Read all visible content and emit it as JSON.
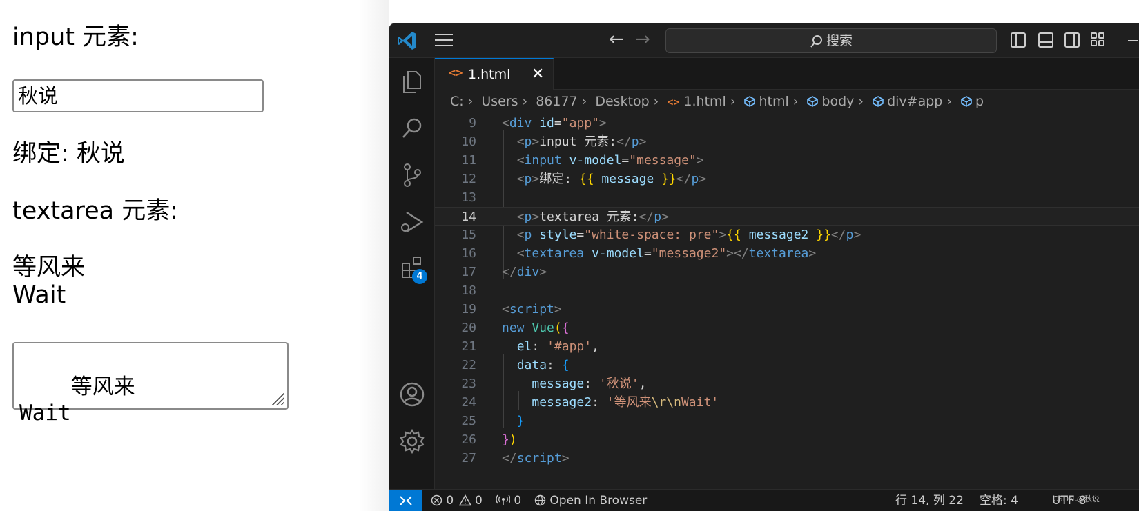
{
  "preview": {
    "p_input_label": "input 元素:",
    "input_value": "秋说",
    "p_bound": "绑定: 秋说",
    "p_textarea_label": "textarea 元素:",
    "pre_text": "等风来\nWait",
    "textarea_value": "等风来\nWait"
  },
  "titlebar": {
    "search_label": "搜索"
  },
  "activity": {
    "extensions_badge": "4"
  },
  "tab": {
    "label": "1.html",
    "close": "✕"
  },
  "breadcrumb": {
    "drive": "C:",
    "users": "Users",
    "user": "86177",
    "desktop": "Desktop",
    "file": "1.html",
    "html": "html",
    "body": "body",
    "app": "div#app",
    "p": "p"
  },
  "code_lines": [
    {
      "n": "9"
    },
    {
      "n": "10"
    },
    {
      "n": "11"
    },
    {
      "n": "12"
    },
    {
      "n": "13"
    },
    {
      "n": "14"
    },
    {
      "n": "15"
    },
    {
      "n": "16"
    },
    {
      "n": "17"
    },
    {
      "n": "18"
    },
    {
      "n": "19"
    },
    {
      "n": "20"
    },
    {
      "n": "21"
    },
    {
      "n": "22"
    },
    {
      "n": "23"
    },
    {
      "n": "24"
    },
    {
      "n": "25"
    },
    {
      "n": "26"
    },
    {
      "n": "27"
    }
  ],
  "code": {
    "l9_tag": "div",
    "l9_attr": "id",
    "l9_val": "\"app\"",
    "l10_tag": "p",
    "l10_text": "input 元素:",
    "l10_close": "p",
    "l11_tag": "input",
    "l11_attr": "v-model",
    "l11_val": "\"message\"",
    "l12_tag": "p",
    "l12_text": "绑定: ",
    "l12_open": "{{",
    "l12_var": " message ",
    "l12_close_br": "}}",
    "l12_close": "p",
    "l14_tag": "p",
    "l14_text": "textarea 元素:",
    "l14_close": "p",
    "l15_tag": "p",
    "l15_attr": "style",
    "l15_val": "\"white-space: pre\"",
    "l15_open": "{{",
    "l15_var": " message2 ",
    "l15_close_br": "}}",
    "l15_close": "p",
    "l16_tag": "textarea",
    "l16_attr": "v-model",
    "l16_val": "\"message2\"",
    "l16_close": "textarea",
    "l17_close": "div",
    "l19_tag": "script",
    "l20_kw": "new",
    "l20_cls": "Vue",
    "l21_prop": "el",
    "l21_val": "'#app'",
    "l22_prop": "data",
    "l23_prop": "message",
    "l23_val": "'秋说'",
    "l24_prop": "message2",
    "l24_val_a": "'等风来",
    "l24_esc": "\\r\\n",
    "l24_val_b": "Wait'",
    "l27_close": "script"
  },
  "status": {
    "errors": "0",
    "warnings": "0",
    "ports": "0",
    "open_in_browser": "Open In Browser",
    "position": "行 14, 列 22",
    "spaces": "空格: 4",
    "encoding": "UTF-8",
    "watermark": "CSDN @秋说"
  }
}
